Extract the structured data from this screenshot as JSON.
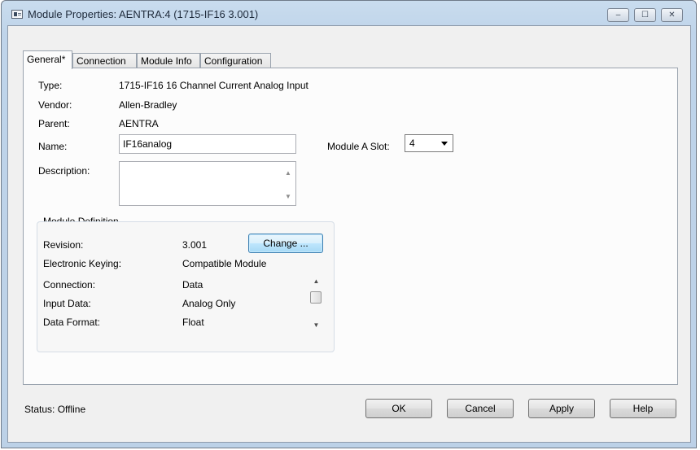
{
  "window": {
    "title": "Module Properties: AENTRA:4 (1715-IF16 3.001)",
    "minimize_glyph": "–",
    "maximize_glyph": "☐",
    "close_glyph": "✕"
  },
  "tabs": [
    {
      "label": "General*"
    },
    {
      "label": "Connection"
    },
    {
      "label": "Module Info"
    },
    {
      "label": "Configuration"
    }
  ],
  "general": {
    "type_label": "Type:",
    "type_value": "1715-IF16 16 Channel Current Analog Input",
    "vendor_label": "Vendor:",
    "vendor_value": "Allen-Bradley",
    "parent_label": "Parent:",
    "parent_value": "AENTRA",
    "name_label": "Name:",
    "name_value": "IF16analog",
    "description_label": "Description:",
    "description_value": "",
    "slot_label": "Module A Slot:",
    "slot_value": "4"
  },
  "module_definition": {
    "title": "Module Definition",
    "revision_label": "Revision:",
    "revision_value": "3.001",
    "change_label": "Change ...",
    "keying_label": "Electronic Keying:",
    "keying_value": "Compatible Module",
    "rows": [
      {
        "label": "Connection:",
        "value": "Data"
      },
      {
        "label": "Input Data:",
        "value": "Analog Only"
      },
      {
        "label": "Data Format:",
        "value": "Float"
      }
    ]
  },
  "footer": {
    "status": "Status:  Offline",
    "ok": "OK",
    "cancel": "Cancel",
    "apply": "Apply",
    "help": "Help"
  }
}
